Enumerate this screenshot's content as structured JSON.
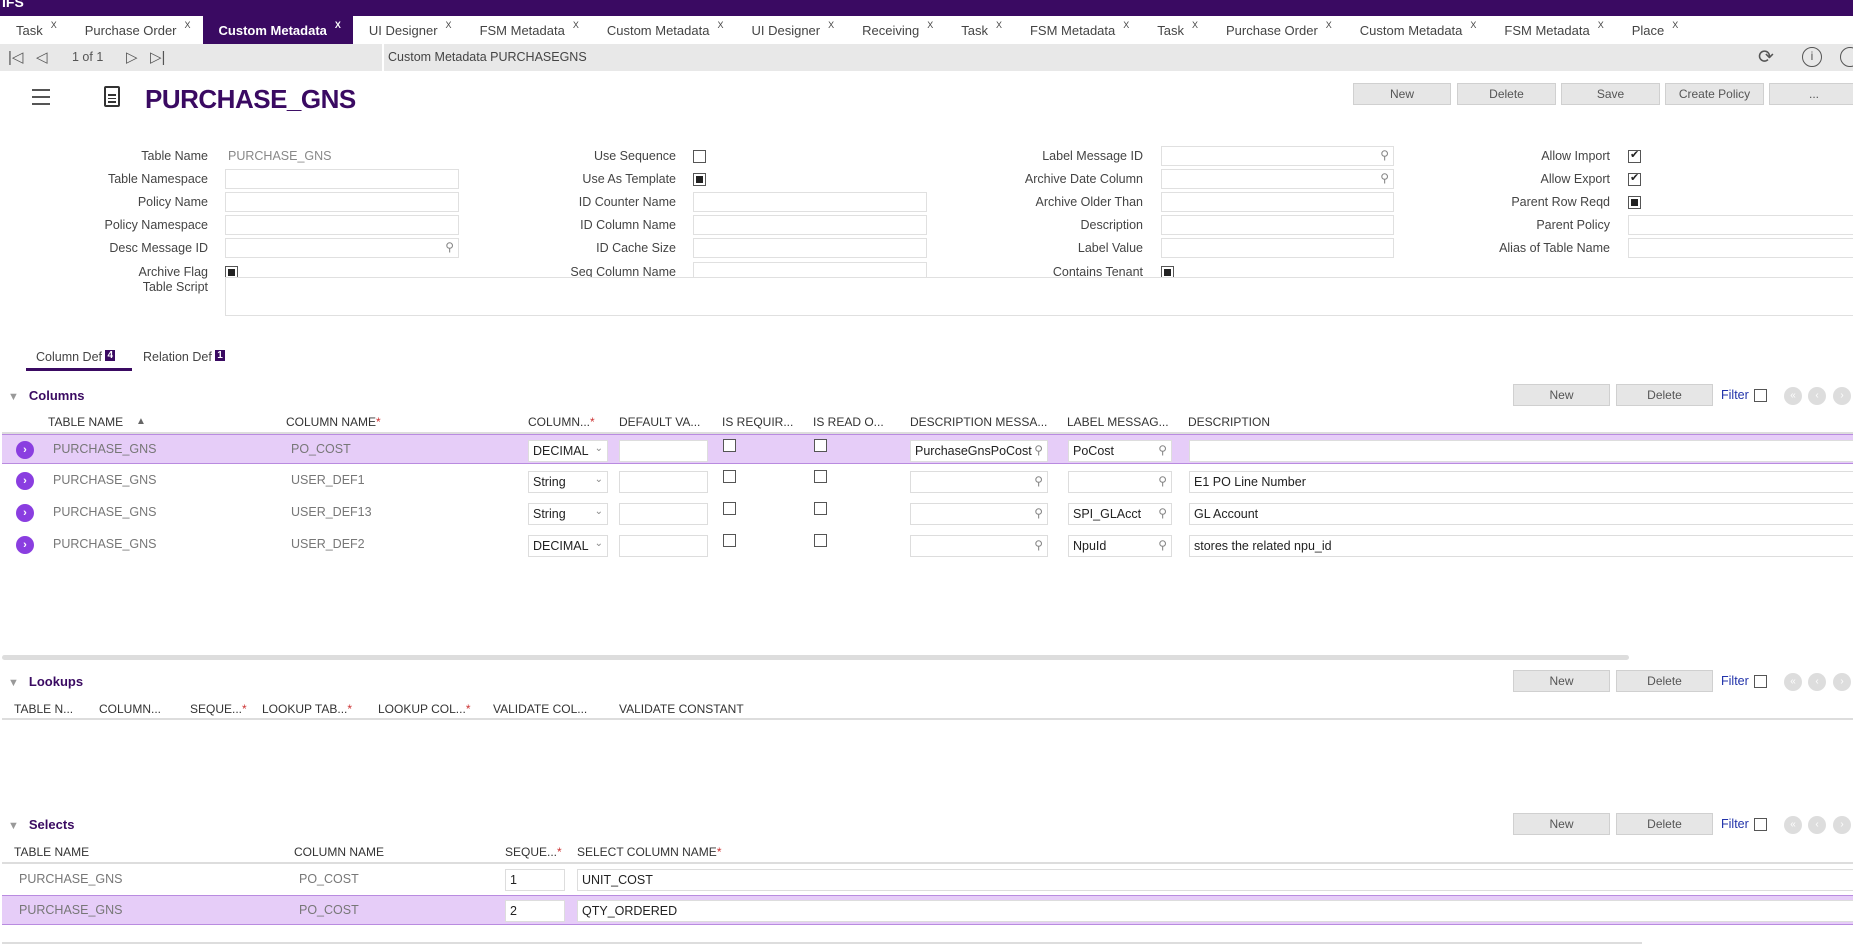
{
  "app": {
    "logo": "IFS",
    "accent": "#3a0a62",
    "selected_row": "#e6cdf8"
  },
  "tabs": [
    {
      "label": "Task"
    },
    {
      "label": "Purchase Order"
    },
    {
      "label": "Custom Metadata",
      "active": true
    },
    {
      "label": "UI Designer"
    },
    {
      "label": "FSM Metadata"
    },
    {
      "label": "Custom Metadata"
    },
    {
      "label": "UI Designer"
    },
    {
      "label": "Receiving"
    },
    {
      "label": "Task"
    },
    {
      "label": "FSM Metadata"
    },
    {
      "label": "Task"
    },
    {
      "label": "Purchase Order"
    },
    {
      "label": "Custom Metadata"
    },
    {
      "label": "FSM Metadata"
    },
    {
      "label": "Place"
    }
  ],
  "tab_close": "X",
  "toolbar": {
    "page_info": "1 of 1",
    "record_title": "Custom Metadata PURCHASEGNS",
    "icons": [
      "first-icon",
      "prev-icon",
      "next-icon",
      "last-icon",
      "refresh-icon",
      "info-icon",
      "help-icon"
    ]
  },
  "header": {
    "title": "PURCHASE_GNS",
    "buttons": {
      "new": "New",
      "delete": "Delete",
      "save": "Save",
      "create_policy": "Create Policy",
      "more": "..."
    }
  },
  "form": {
    "col1": [
      {
        "label": "Table Name",
        "value": "PURCHASE_GNS",
        "type": "readonly"
      },
      {
        "label": "Table Namespace",
        "value": "",
        "type": "text"
      },
      {
        "label": "Policy Name",
        "value": "",
        "type": "text"
      },
      {
        "label": "Policy Namespace",
        "value": "",
        "type": "text"
      },
      {
        "label": "Desc Message ID",
        "value": "",
        "type": "lookup"
      },
      {
        "label": "Archive Flag",
        "type": "checkbox",
        "state": "indeterminate"
      }
    ],
    "col2": [
      {
        "label": "Use Sequence",
        "type": "checkbox",
        "state": "unchecked"
      },
      {
        "label": "Use As Template",
        "type": "checkbox",
        "state": "indeterminate"
      },
      {
        "label": "ID Counter Name",
        "value": "",
        "type": "text"
      },
      {
        "label": "ID Column Name",
        "value": "",
        "type": "text"
      },
      {
        "label": "ID Cache Size",
        "value": "",
        "type": "text"
      },
      {
        "label": "Seq Column Name",
        "value": "",
        "type": "text"
      }
    ],
    "col3": [
      {
        "label": "Label Message ID",
        "value": "",
        "type": "lookup"
      },
      {
        "label": "Archive Date Column",
        "value": "",
        "type": "lookup"
      },
      {
        "label": "Archive Older Than",
        "value": "",
        "type": "text"
      },
      {
        "label": "Description",
        "value": "",
        "type": "text"
      },
      {
        "label": "Label Value",
        "value": "",
        "type": "text"
      },
      {
        "label": "Contains Tenant",
        "type": "checkbox",
        "state": "indeterminate"
      }
    ],
    "col4": [
      {
        "label": "Allow Import",
        "type": "checkbox",
        "state": "checked"
      },
      {
        "label": "Allow Export",
        "type": "checkbox",
        "state": "checked"
      },
      {
        "label": "Parent Row Reqd",
        "type": "checkbox",
        "state": "indeterminate"
      },
      {
        "label": "Parent Policy",
        "value": "",
        "type": "lookup"
      },
      {
        "label": "Alias of Table Name",
        "value": "",
        "type": "text"
      }
    ],
    "table_script": {
      "label": "Table Script",
      "value": ""
    }
  },
  "subtabs": [
    {
      "label": "Column Def",
      "count": "4",
      "active": true
    },
    {
      "label": "Relation Def",
      "count": "1"
    }
  ],
  "common": {
    "new": "New",
    "delete": "Delete",
    "filter": "Filter"
  },
  "columns": {
    "title": "Columns",
    "headers": [
      "TABLE NAME",
      "COLUMN NAME",
      "COLUMN...",
      "DEFAULT VA...",
      "IS REQUIR...",
      "IS READ O...",
      "DESCRIPTION MESSA...",
      "LABEL MESSAG...",
      "DESCRIPTION"
    ],
    "sort_indicator": "▲",
    "rows": [
      {
        "table": "PURCHASE_GNS",
        "column": "PO_COST",
        "type": "DECIMAL",
        "default": "",
        "required": false,
        "readonly": false,
        "desc_msg": "PurchaseGnsPoCost",
        "label_msg": "PoCost",
        "description": "",
        "selected": true
      },
      {
        "table": "PURCHASE_GNS",
        "column": "USER_DEF1",
        "type": "String",
        "default": "",
        "required": false,
        "readonly": false,
        "desc_msg": "",
        "label_msg": "",
        "description": "E1 PO Line Number"
      },
      {
        "table": "PURCHASE_GNS",
        "column": "USER_DEF13",
        "type": "String",
        "default": "",
        "required": false,
        "readonly": false,
        "desc_msg": "",
        "label_msg": "SPI_GLAcct",
        "description": "GL Account"
      },
      {
        "table": "PURCHASE_GNS",
        "column": "USER_DEF2",
        "type": "DECIMAL",
        "default": "",
        "required": false,
        "readonly": false,
        "desc_msg": "",
        "label_msg": "NpuId",
        "description": "stores the related npu_id"
      }
    ]
  },
  "lookups": {
    "title": "Lookups",
    "headers": [
      "TABLE N...",
      "COLUMN...",
      "SEQUE...",
      "LOOKUP TAB...",
      "LOOKUP COL...",
      "VALIDATE COL...",
      "VALIDATE CONSTANT"
    ]
  },
  "selects": {
    "title": "Selects",
    "headers": [
      "TABLE NAME",
      "COLUMN NAME",
      "SEQUE...",
      "SELECT COLUMN NAME"
    ],
    "rows": [
      {
        "table": "PURCHASE_GNS",
        "column": "PO_COST",
        "seq": "1",
        "select_column": "UNIT_COST"
      },
      {
        "table": "PURCHASE_GNS",
        "column": "PO_COST",
        "seq": "2",
        "select_column": "QTY_ORDERED",
        "selected": true
      }
    ]
  }
}
